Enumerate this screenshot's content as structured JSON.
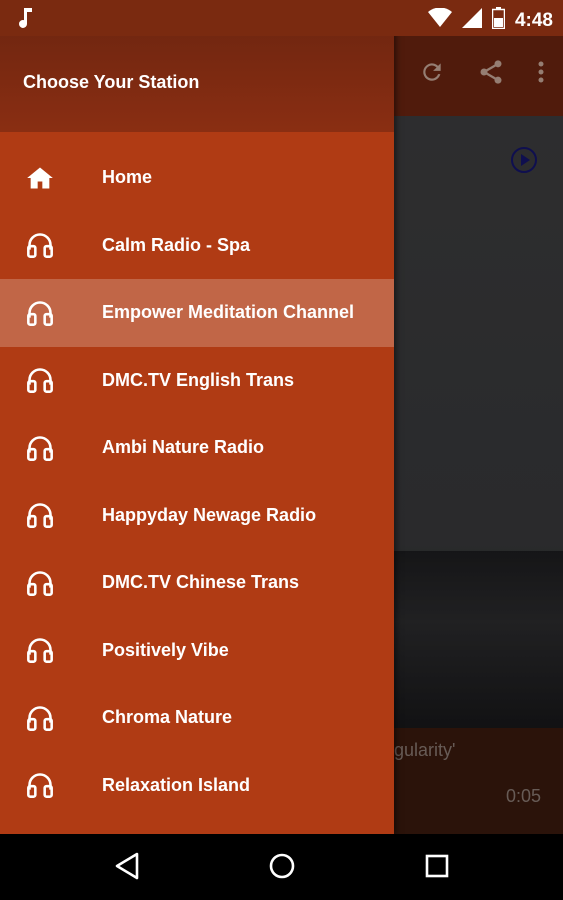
{
  "status": {
    "time": "4:48",
    "icons": [
      "music-note-icon",
      "wifi-icon",
      "signal-icon",
      "battery-icon"
    ]
  },
  "toolbar": {
    "icons": [
      "refresh-icon",
      "share-icon",
      "more-vert-icon"
    ]
  },
  "content": {
    "caption": "ingularity'",
    "duration": "0:05"
  },
  "drawer": {
    "title": "Choose Your Station",
    "items": [
      {
        "label": "Home",
        "icon": "home-icon",
        "active": false
      },
      {
        "label": "Calm Radio - Spa",
        "icon": "headphones-icon",
        "active": false
      },
      {
        "label": "Empower Meditation Channel",
        "icon": "headphones-icon",
        "active": true
      },
      {
        "label": "DMC.TV English Trans",
        "icon": "headphones-icon",
        "active": false
      },
      {
        "label": "Ambi Nature Radio",
        "icon": "headphones-icon",
        "active": false
      },
      {
        "label": "Happyday Newage Radio",
        "icon": "headphones-icon",
        "active": false
      },
      {
        "label": "DMC.TV Chinese Trans",
        "icon": "headphones-icon",
        "active": false
      },
      {
        "label": "Positively Vibe",
        "icon": "headphones-icon",
        "active": false
      },
      {
        "label": "Chroma Nature",
        "icon": "headphones-icon",
        "active": false
      },
      {
        "label": "Relaxation Island",
        "icon": "headphones-icon",
        "active": false
      }
    ]
  },
  "colors": {
    "drawer": "#b03b14",
    "accent": "#7a2a10"
  },
  "navbar": {
    "buttons": [
      "back-icon",
      "home-circle-icon",
      "recents-icon"
    ]
  }
}
